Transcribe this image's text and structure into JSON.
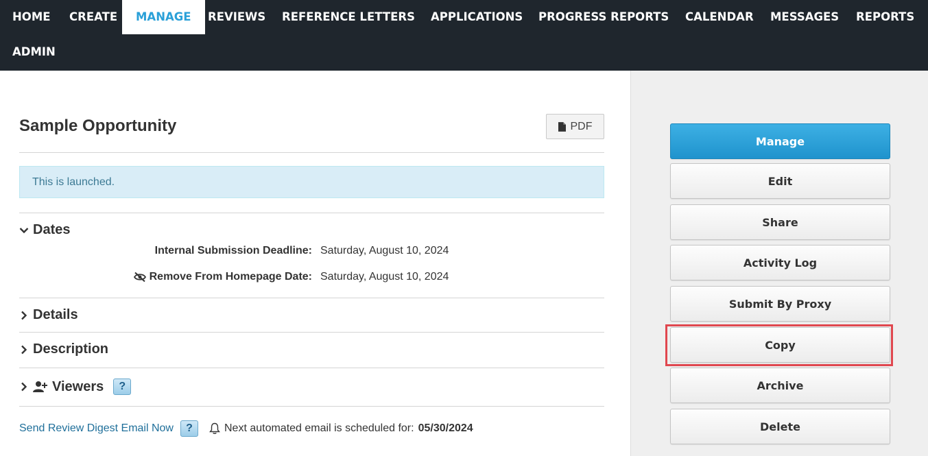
{
  "nav": {
    "items": [
      {
        "label": "HOME",
        "active": false
      },
      {
        "label": "CREATE",
        "active": false
      },
      {
        "label": "MANAGE",
        "active": true
      },
      {
        "label": "REVIEWS",
        "active": false
      },
      {
        "label": "REFERENCE LETTERS",
        "active": false
      },
      {
        "label": "APPLICATIONS",
        "active": false
      },
      {
        "label": "PROGRESS REPORTS",
        "active": false
      },
      {
        "label": "CALENDAR",
        "active": false
      },
      {
        "label": "MESSAGES",
        "active": false
      },
      {
        "label": "REPORTS",
        "active": false
      },
      {
        "label": "ADMIN",
        "active": false
      }
    ]
  },
  "page": {
    "title": "Sample Opportunity",
    "pdf_label": "PDF",
    "alert": "This is launched."
  },
  "sections": {
    "dates": {
      "heading": "Dates",
      "rows": [
        {
          "label": "Internal Submission Deadline:",
          "value": "Saturday, August 10, 2024"
        },
        {
          "label": "Remove From Homepage Date:",
          "value": "Saturday, August 10, 2024",
          "icon": "eye-slash-icon"
        }
      ]
    },
    "details": {
      "heading": "Details"
    },
    "description": {
      "heading": "Description"
    },
    "viewers": {
      "heading": "Viewers",
      "help": "?"
    }
  },
  "footer": {
    "digest_link": "Send Review Digest Email Now",
    "help": "?",
    "schedule_text": "Next automated email is scheduled for:",
    "schedule_date": "05/30/2024"
  },
  "sidebar": {
    "buttons": [
      {
        "label": "Manage",
        "primary": true
      },
      {
        "label": "Edit"
      },
      {
        "label": "Share"
      },
      {
        "label": "Activity Log"
      },
      {
        "label": "Submit By Proxy"
      },
      {
        "label": "Copy",
        "highlighted": true
      },
      {
        "label": "Archive"
      },
      {
        "label": "Delete"
      }
    ]
  },
  "colors": {
    "nav_bg": "#1f262d",
    "accent": "#2aa0d8",
    "highlight": "#e0474f",
    "alert_bg": "#d9edf7"
  }
}
